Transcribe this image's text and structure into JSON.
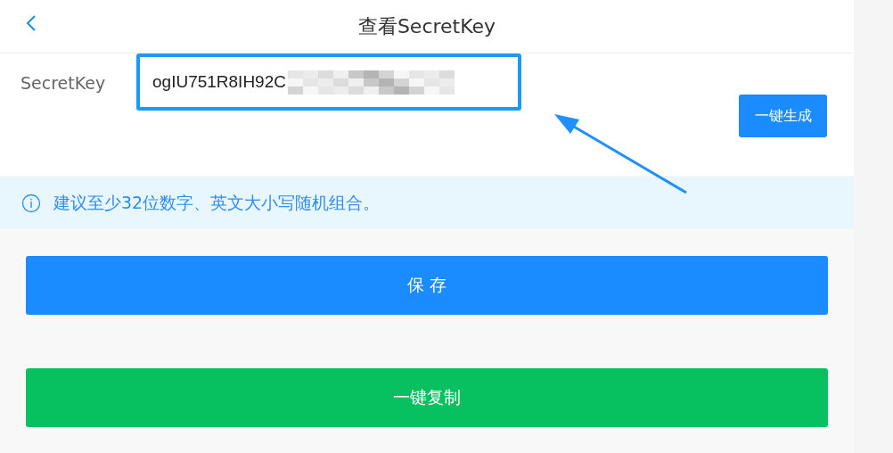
{
  "header": {
    "title": "查看SecretKey"
  },
  "form": {
    "label": "SecretKey",
    "value": "ogIU751R8IH92C",
    "focused": true
  },
  "generate_button": {
    "label": "一键生成"
  },
  "tip": {
    "text": "建议至少32位数字、英文大小写随机组合。"
  },
  "save_button": {
    "label": "保 存"
  },
  "copy_button": {
    "label": "一键复制"
  }
}
